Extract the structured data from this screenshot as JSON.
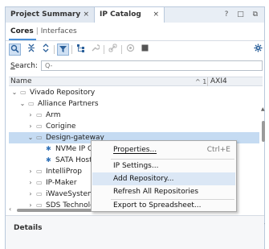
{
  "tabs": [
    {
      "label": "Project Summary",
      "close": "×"
    },
    {
      "label": "IP Catalog",
      "close": "×"
    }
  ],
  "window_controls": "? □ ⧉",
  "subtabs": {
    "cores": "Cores",
    "separator": "|",
    "interfaces": "Interfaces"
  },
  "toolbar": {
    "icons": [
      "search-icon",
      "collapse-all-icon",
      "expand-all-icon",
      "filter-icon",
      "hierarchy-icon",
      "wrench-icon",
      "link-icon",
      "circle-icon",
      "stop-icon",
      "gear-icon"
    ]
  },
  "search": {
    "label_prefix": "S",
    "label_rest": "earch:",
    "placeholder": "Q-"
  },
  "table": {
    "col_name": "Name",
    "sort_indicator": "^ 1",
    "col_axi": "AXI4"
  },
  "tree": [
    {
      "label": "Vivado Repository",
      "expanded": true,
      "level": 0
    },
    {
      "label": "Alliance Partners",
      "expanded": true,
      "level": 1
    },
    {
      "label": "Arm",
      "expanded": false,
      "level": 2
    },
    {
      "label": "Corigine",
      "expanded": false,
      "level": 2
    },
    {
      "label": "Design-gateway",
      "expanded": true,
      "level": 2,
      "selected": true
    },
    {
      "label": "NVMe IP Co",
      "level": 3,
      "leaf": true
    },
    {
      "label": "SATA Host",
      "level": 3,
      "leaf": true
    },
    {
      "label": "IntelliProp",
      "expanded": false,
      "level": 2
    },
    {
      "label": "IP-Maker",
      "expanded": false,
      "level": 2
    },
    {
      "label": "iWaveSystems",
      "expanded": false,
      "level": 2
    },
    {
      "label": "SDS Technologies",
      "expanded": false,
      "level": 2
    }
  ],
  "details": {
    "title": "Details"
  },
  "context_menu": {
    "items": [
      {
        "label": "Properties...",
        "shortcut": "Ctrl+E"
      },
      {
        "label": "IP Settings...",
        "shortcut": ""
      },
      {
        "label": "Add Repository...",
        "shortcut": "",
        "highlighted": true
      },
      {
        "label": "Refresh All Repositories",
        "shortcut": ""
      },
      {
        "label": "Export to Spreadsheet...",
        "shortcut": ""
      }
    ]
  },
  "colors": {
    "accent": "#4a90d9",
    "selection": "#c5dbf2",
    "menu_highlight": "#dbe7f5",
    "tab_bar": "#e8eef5"
  }
}
